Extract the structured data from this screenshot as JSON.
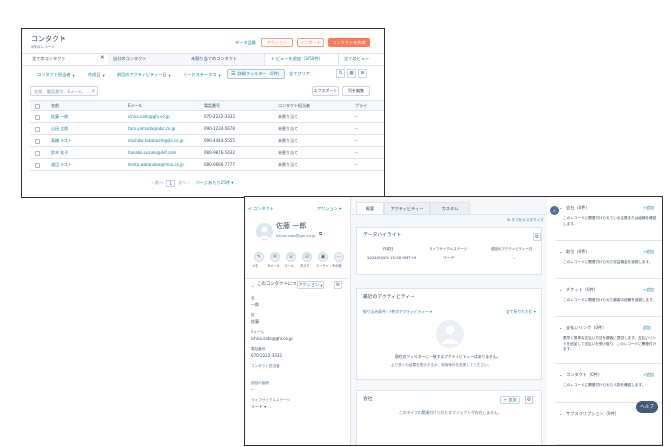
{
  "list": {
    "title": "コンタクト",
    "count": "9件のレコード",
    "header_actions": {
      "data_quality": "データ品質",
      "actions": "アクション",
      "import": "インポート",
      "create": "コンタクトを作成"
    },
    "view_tabs": [
      "全てのコンタクト",
      "自分のコンタクト",
      "未割り当てのコンタクト"
    ],
    "add_view": "+ ビューを追加（3/50件）",
    "all_views": "全てのビュー",
    "filters": [
      "コンタクト担当者",
      "作成日",
      "前回のアクティビティー日",
      "リードステータス"
    ],
    "advanced_filter": "詳細フィルター（0件）",
    "clear_all": "全てクリア",
    "search_placeholder": "名前、電話番号、Eメール、…",
    "export": "エクスポート",
    "edit_columns": "列を編集",
    "columns": [
      "名前",
      "Eメール",
      "電話番号",
      "コンタクト担当者",
      "プライ"
    ],
    "rows": [
      {
        "name": "佐藤 一郎",
        "email": "ichiro.sato@ghi.co.jp",
        "phone": "070-2222-3333",
        "owner": "未割り当て",
        "extra": "--"
      },
      {
        "name": "山田 太郎",
        "email": "taro.yamada@abc.co.jp",
        "phone": "090-1234-5678",
        "owner": "未割り当て",
        "extra": "--"
      },
      {
        "name": "高橋 テスト",
        "email": "michiko.takahashi@jkl.co.jp",
        "phone": "090-4444-5555",
        "owner": "未割り当て",
        "extra": "--"
      },
      {
        "name": "鈴木 花子",
        "email": "hanako.suzuki@def.com",
        "phone": "080-9876-5432",
        "owner": "未割り当て",
        "extra": "--"
      },
      {
        "name": "渡辺 テスト",
        "email": "kenta.watanabe@mno.co.jp",
        "phone": "080-6666-7777",
        "owner": "未割り当て",
        "extra": "--"
      }
    ],
    "pagination": {
      "prev": "前へ",
      "page": "1",
      "next": "次へ",
      "per_page": "ページあたり25件"
    }
  },
  "detail": {
    "back": "< コンタクト",
    "actions": "アクション",
    "contact_name": "佐藤 一郎",
    "contact_email": "ichiro.sato@ghi.co.jp",
    "action_icons": [
      "メモ",
      "Eメール",
      "コール",
      "タスク",
      "ミーティ…",
      "その他"
    ],
    "about_title": "このコンタクトについて",
    "about_action": "アクション",
    "fields": [
      {
        "label": "名",
        "value": "一郎"
      },
      {
        "label": "姓",
        "value": "佐藤"
      },
      {
        "label": "Eメール",
        "value": "ichiro.sato@ghi.co.jp"
      },
      {
        "label": "電話番号",
        "value": "070-2222-3333"
      },
      {
        "label": "コンタクト担当者",
        "value": ""
      },
      {
        "label": "前回の接続",
        "value": "--"
      },
      {
        "label": "ライフサイクルステージ",
        "value": "リード ▾"
      }
    ],
    "tabs": [
      "概要",
      "アクティビティー",
      "カスタム"
    ],
    "customize_tabs": "⚙ タブをカスタマイズ",
    "highlights": {
      "title": "データハイライト",
      "cols": [
        {
          "label": "作成日",
          "value": "2024/04/05 15:26 GMT+9"
        },
        {
          "label": "ライフサイクルステージ",
          "value": "リード"
        },
        {
          "label": "前回のアクティビティー日",
          "value": "--"
        }
      ]
    },
    "recent": {
      "title": "最近のアクティビティー",
      "filter_label": "絞り込み条件:",
      "filter_value": "7件のアクティビティー ▾",
      "all_link": "全て折りたたむ ▾",
      "empty_title": "現在のフィルターに一致するアクティビティーはありません。",
      "empty_sub": "より多くの結果を表示するか、検索条件を変更してください。"
    },
    "company": {
      "title": "会社",
      "add": "+ 追加",
      "empty": "このタイプの関連付けられたオブジェクトが存在しません。"
    },
    "sidebar": [
      {
        "title": "会社（0件）",
        "action": "+追加",
        "body": "このレコードに関連付けられている企業または組織を確認します。"
      },
      {
        "title": "取引（0件）",
        "action": "+追加",
        "body": "このレコードに関連付けられた収益機会を追跡します。"
      },
      {
        "title": "チケット（0件）",
        "action": "+追加",
        "body": "このレコードに関連付けられた顧客の依頼を追跡します。"
      },
      {
        "title": "支払いリンク（0件）",
        "action": "追加",
        "body": "素早く簡単な支払い方法を顧客に提供します。支払いリンクを追加して支払いを受け取り、このレコードに関連付けます。"
      },
      {
        "title": "コンタクト（0件）",
        "action": "+追加",
        "body": "このレコードに関連付けられた人物を確認します。"
      },
      {
        "title": "サブスクリプション（0件）",
        "action": "",
        "body": ""
      }
    ],
    "help": "ヘルプ"
  },
  "colors": {
    "accent": "#ff7a59",
    "link": "#0b7ea0",
    "border": "#dfe3eb"
  }
}
